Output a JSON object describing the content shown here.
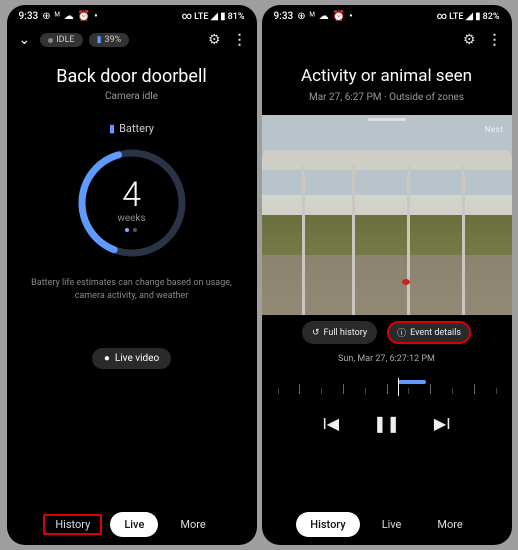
{
  "left": {
    "status": {
      "time": "9:33",
      "net": "LTE",
      "batt": "81%"
    },
    "header": {
      "chip_idle": "IDLE",
      "chip_batt": "39%"
    },
    "title": "Back door doorbell",
    "subtitle": "Camera idle",
    "battery_label": "Battery",
    "ring_value": "4",
    "ring_unit": "weeks",
    "estimate": "Battery life estimates can change based on usage, camera activity, and weather",
    "live_chip": "Live video",
    "tabs": {
      "history": "History",
      "live": "Live",
      "more": "More"
    }
  },
  "right": {
    "status": {
      "time": "9:33",
      "net": "LTE",
      "batt": "82%"
    },
    "title": "Activity or animal seen",
    "subtitle": "Mar 27, 6:27 PM · Outside of zones",
    "nest": "Nest",
    "pill_full_history": "Full history",
    "pill_event_details": "Event details",
    "timestamp": "Sun, Mar 27, 6:27:12 PM",
    "tabs": {
      "history": "History",
      "live": "Live",
      "more": "More"
    }
  }
}
